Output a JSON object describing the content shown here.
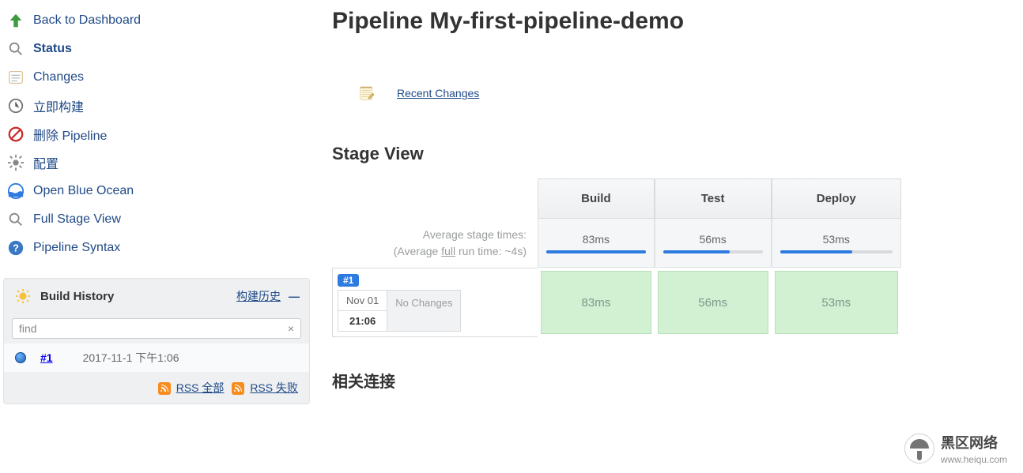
{
  "sidebar": {
    "items": [
      {
        "label": "Back to Dashboard"
      },
      {
        "label": "Status"
      },
      {
        "label": "Changes"
      },
      {
        "label": "立即构建"
      },
      {
        "label": "删除 Pipeline"
      },
      {
        "label": "配置"
      },
      {
        "label": "Open Blue Ocean"
      },
      {
        "label": "Full Stage View"
      },
      {
        "label": "Pipeline Syntax"
      }
    ]
  },
  "history": {
    "title": "Build History",
    "trend_label": "构建历史",
    "search_value": "find",
    "builds": [
      {
        "num": "#1",
        "timestamp": "2017-11-1 下午1:06"
      }
    ],
    "rss_all": "RSS 全部",
    "rss_fail": "RSS 失败"
  },
  "page": {
    "title": "Pipeline My-first-pipeline-demo",
    "recent_changes": "Recent Changes",
    "stage_view_title": "Stage View",
    "related_title": "相关连接"
  },
  "stages": {
    "avg_label": "Average stage times:",
    "avg_full_prefix": "(Average ",
    "avg_full_word": "full",
    "avg_full_suffix": " run time: ~4s)",
    "columns": [
      "Build",
      "Test",
      "Deploy"
    ],
    "avg": [
      "83ms",
      "56ms",
      "53ms"
    ],
    "avg_pct": [
      100,
      67,
      64
    ],
    "runs": [
      {
        "badge": "#1",
        "date": "Nov 01",
        "time": "21:06",
        "changes": "No\nChanges",
        "cells": [
          "83ms",
          "56ms",
          "53ms"
        ]
      }
    ]
  },
  "watermark": {
    "text": "黑区网络",
    "sub": "www.heiqu.com"
  }
}
